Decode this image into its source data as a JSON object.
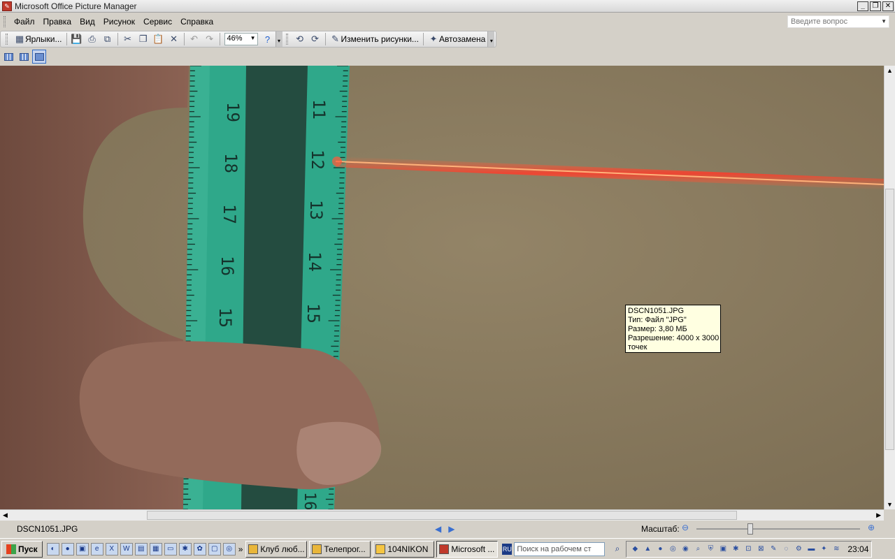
{
  "window": {
    "title": "Microsoft Office Picture Manager",
    "minimize_glyph": "_",
    "maximize_glyph": "❐",
    "close_glyph": "✕"
  },
  "menu": {
    "items": [
      "Файл",
      "Правка",
      "Вид",
      "Рисунок",
      "Сервис",
      "Справка"
    ],
    "question_placeholder": "Введите вопрос"
  },
  "toolbar": {
    "shortcuts_label": "Ярлыки...",
    "zoom_value": "46%",
    "edit_pictures_label": "Изменить рисунки...",
    "autocorrect_label": "Автозамена"
  },
  "tooltip": {
    "line1": "DSCN1051.JPG",
    "line2": "Тип: Файл \"JPG\"",
    "line3": "Размер: 3,80 МБ",
    "line4": "Разрешение: 4000 x 3000",
    "line5": "точек"
  },
  "status": {
    "file_name": "DSCN1051.JPG",
    "zoom_label": "Масштаб:",
    "zoom_level": 0.33
  },
  "ruler": {
    "left_labels": [
      "19",
      "18",
      "17",
      "16",
      "15"
    ],
    "right_labels": [
      "11",
      "12",
      "13",
      "14",
      "15",
      "16"
    ]
  },
  "taskbar": {
    "start_label": "Пуск",
    "overflow_glyph": "»",
    "tasks": [
      {
        "label": "Клуб люб..."
      },
      {
        "label": "Телепрог..."
      },
      {
        "label": "104NIKON"
      },
      {
        "label": "Microsoft ..."
      }
    ],
    "lang": "RU",
    "search_placeholder": "Поиск на рабочем ст",
    "clock": "23:04"
  },
  "colors": {
    "accent": "#316ac5",
    "laser": "#ff3b2a",
    "ruler": "#2fa88a",
    "wall": "#8a7b5f"
  }
}
